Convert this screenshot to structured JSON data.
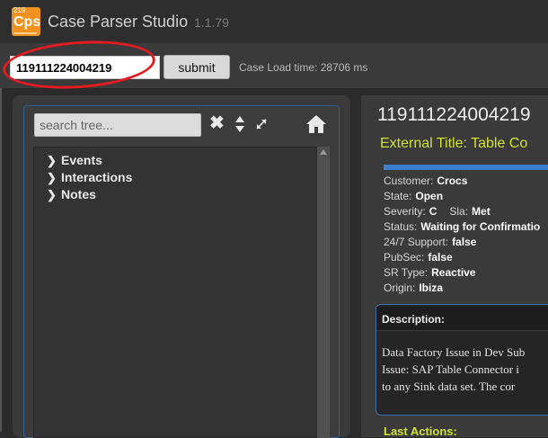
{
  "app": {
    "logo_version": "219",
    "logo_text": "Cps",
    "title": "Case Parser Studio",
    "version": "1.1.79",
    "accent_color": "#f0921e"
  },
  "toolbar": {
    "case_number_value": "119111224004219",
    "submit_label": "submit",
    "load_time_text": "Case Load time: 28706 ms"
  },
  "tree": {
    "search_placeholder": "search tree...",
    "tools": [
      "close-icon",
      "sort-icon",
      "expand-icon",
      "home-icon"
    ],
    "items": [
      {
        "label": "Events",
        "icon": "chevron-right-icon"
      },
      {
        "label": "Interactions",
        "icon": "chevron-right-icon"
      },
      {
        "label": "Notes",
        "icon": "chevron-right-icon"
      }
    ]
  },
  "case": {
    "number": "119111224004219",
    "external_title": "External Title: Table Co",
    "progress_fraction": 1.0,
    "fields": {
      "customer_label": "Customer:",
      "customer_value": "Crocs",
      "state_label": "State:",
      "state_value": "Open",
      "severity_label": "Severity:",
      "severity_value": "C",
      "sla_label": "Sla:",
      "sla_value": "Met",
      "status_label": "Status:",
      "status_value": "Waiting for Confirmatio",
      "support_label": "24/7 Support:",
      "support_value": "false",
      "pubsec_label": "PubSec:",
      "pubsec_value": "false",
      "srtype_label": "SR Type:",
      "srtype_value": "Reactive",
      "origin_label": "Origin:",
      "origin_value": "Ibiza"
    },
    "description": {
      "label": "Description:",
      "lines": [
        "Data Factory Issue in Dev Sub",
        "Issue:  SAP Table Connector i",
        "to any Sink data set.  The cor"
      ]
    },
    "last_actions_label": "Last Actions:",
    "title_color": "#cfe32a"
  }
}
